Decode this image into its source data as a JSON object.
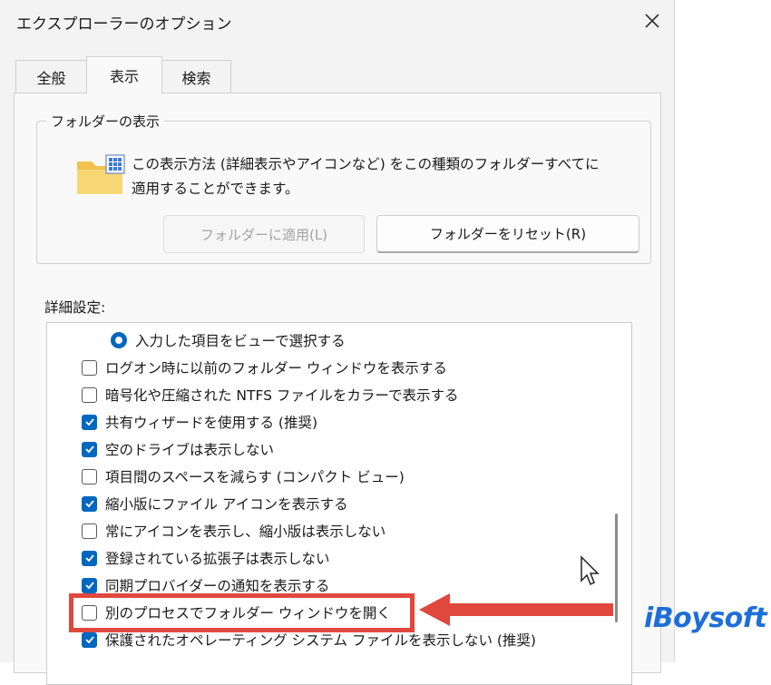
{
  "window": {
    "title": "エクスプローラーのオプション"
  },
  "tabs": [
    {
      "label": "全般",
      "active": false
    },
    {
      "label": "表示",
      "active": true
    },
    {
      "label": "検索",
      "active": false
    }
  ],
  "folder_views": {
    "group_title": "フォルダーの表示",
    "description_line1": "この表示方法 (詳細表示やアイコンなど) をこの種類のフォルダーすべてに",
    "description_line2": "適用することができます。",
    "apply_button": "フォルダーに適用(L)",
    "reset_button": "フォルダーをリセット(R)"
  },
  "advanced": {
    "label": "詳細設定:",
    "items": [
      {
        "type": "radio",
        "label": "入力した項目をビューで選択する",
        "checked": true
      },
      {
        "type": "checkbox",
        "label": "ログオン時に以前のフォルダー ウィンドウを表示する",
        "checked": false
      },
      {
        "type": "checkbox",
        "label": "暗号化や圧縮された NTFS ファイルをカラーで表示する",
        "checked": false
      },
      {
        "type": "checkbox",
        "label": "共有ウィザードを使用する (推奨)",
        "checked": true
      },
      {
        "type": "checkbox",
        "label": "空のドライブは表示しない",
        "checked": true
      },
      {
        "type": "checkbox",
        "label": "項目間のスペースを減らす (コンパクト ビュー)",
        "checked": false
      },
      {
        "type": "checkbox",
        "label": "縮小版にファイル アイコンを表示する",
        "checked": true
      },
      {
        "type": "checkbox",
        "label": "常にアイコンを表示し、縮小版は表示しない",
        "checked": false
      },
      {
        "type": "checkbox",
        "label": "登録されている拡張子は表示しない",
        "checked": true
      },
      {
        "type": "checkbox",
        "label": "同期プロバイダーの通知を表示する",
        "checked": true
      },
      {
        "type": "checkbox",
        "label": "別のプロセスでフォルダー ウィンドウを開く",
        "checked": false
      },
      {
        "type": "checkbox",
        "label": "保護されたオペレーティング システム ファイルを表示しない (推奨)",
        "checked": true
      }
    ]
  },
  "watermark": {
    "text": "iBoysoft"
  },
  "colors": {
    "accent": "#0067c0",
    "highlight": "#e0483e",
    "logo": "#1d6fd8"
  }
}
